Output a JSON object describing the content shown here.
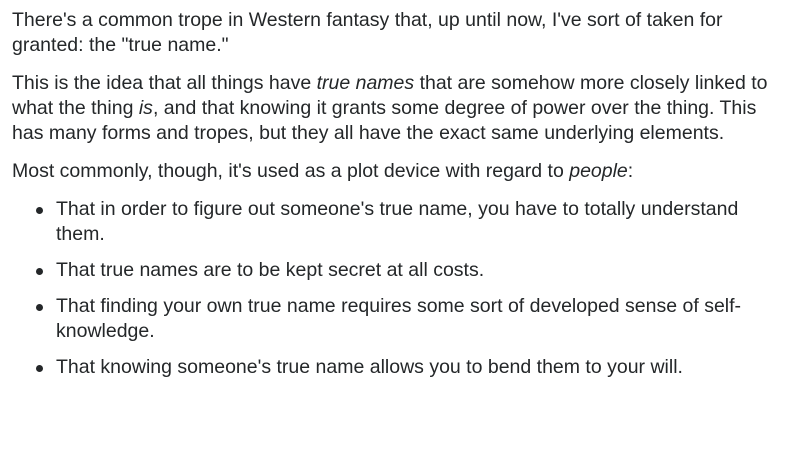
{
  "paragraphs": {
    "p1": "There's a common trope in Western fantasy that, up until now, I've sort of taken for granted: the \"true name.\"",
    "p2": {
      "a": "This is the idea that all things have ",
      "b": "true names",
      "c": " that are somehow more closely linked to what the thing ",
      "d": "is",
      "e": ", and that knowing it grants some degree of power over the thing. This has many forms and tropes, but they all have the exact same underlying elements."
    },
    "p3": {
      "a": "Most commonly, though, it's used as a plot device with regard to ",
      "b": "people",
      "c": ":"
    }
  },
  "list_items": [
    "That in order to figure out someone's true name, you have to totally understand them.",
    "That true names are to be kept secret at all costs.",
    "That finding your own true name requires some sort of developed sense of self-knowledge.",
    "That knowing someone's true name allows you to bend them to your will."
  ]
}
